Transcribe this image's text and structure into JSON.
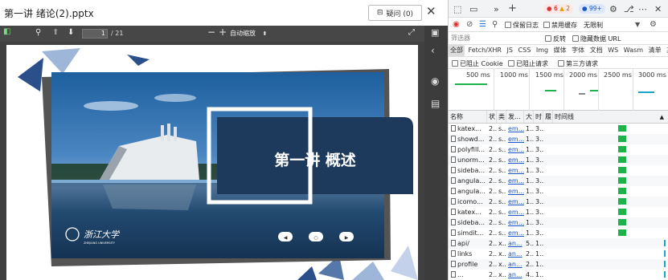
{
  "viewer": {
    "title": "第一讲 绪论(2).pptx",
    "question_button": "疑问 (0)",
    "page_current": "1",
    "page_total": "/ 21",
    "zoom_label": "自动缩放"
  },
  "slide": {
    "title": "第一讲  概述",
    "logo_text": "浙江大学",
    "logo_subtext": "ZHEJIANG UNIVERSITY",
    "nav_buttons": [
      "◀",
      "○",
      "▶"
    ]
  },
  "devtools": {
    "badges": {
      "errors": "6",
      "warnings": "2",
      "info": "99+"
    },
    "row2": {
      "preserve_log": "保留日志",
      "disable_cache": "禁用缓存",
      "throttle": "无限制"
    },
    "filter_placeholder": "筛选器",
    "invert": "反转",
    "hide_data_urls": "隐藏数据 URL",
    "type_tabs": [
      "全部",
      "Fetch/XHR",
      "JS",
      "CSS",
      "Img",
      "媒体",
      "字体",
      "文档",
      "WS",
      "Wasm",
      "清单",
      "其他"
    ],
    "blocked_cookies": "已阻止 Cookie",
    "blocked_requests": "已阻止请求",
    "third_party": "第三方请求",
    "timeline_labels": [
      "500 ms",
      "1000 ms",
      "1500 ms",
      "2000 ms",
      "2500 ms",
      "3000 ms"
    ],
    "columns": {
      "name": "名称",
      "status": "状",
      "type": "类",
      "initiator": "发...",
      "size": "大",
      "time": "时",
      "priority": "履",
      "waterfall": "时间线"
    },
    "requests": [
      {
        "name": "katex...",
        "status": "2...",
        "type": "s...",
        "initiator": "em...",
        "size": "1...",
        "time": "3...",
        "wf": 0.56,
        "wfw": 0.07
      },
      {
        "name": "showd...",
        "status": "2...",
        "type": "s...",
        "initiator": "em...",
        "size": "1...",
        "time": "3...",
        "wf": 0.56,
        "wfw": 0.07
      },
      {
        "name": "polyfill...",
        "status": "2...",
        "type": "s...",
        "initiator": "em...",
        "size": "1...",
        "time": "3...",
        "wf": 0.56,
        "wfw": 0.07
      },
      {
        "name": "unorm...",
        "status": "2...",
        "type": "s...",
        "initiator": "em...",
        "size": "1...",
        "time": "3...",
        "wf": 0.56,
        "wfw": 0.07
      },
      {
        "name": "sideba...",
        "status": "2...",
        "type": "s...",
        "initiator": "em...",
        "size": "1...",
        "time": "3...",
        "wf": 0.56,
        "wfw": 0.07
      },
      {
        "name": "angula...",
        "status": "2...",
        "type": "s...",
        "initiator": "em...",
        "size": "1...",
        "time": "3...",
        "wf": 0.56,
        "wfw": 0.07
      },
      {
        "name": "angula...",
        "status": "2...",
        "type": "s...",
        "initiator": "em...",
        "size": "1...",
        "time": "3...",
        "wf": 0.56,
        "wfw": 0.07
      },
      {
        "name": "icomo...",
        "status": "2...",
        "type": "s...",
        "initiator": "em...",
        "size": "1...",
        "time": "3...",
        "wf": 0.56,
        "wfw": 0.07
      },
      {
        "name": "katex...",
        "status": "2...",
        "type": "s...",
        "initiator": "em...",
        "size": "1...",
        "time": "3...",
        "wf": 0.56,
        "wfw": 0.07
      },
      {
        "name": "sideba...",
        "status": "2...",
        "type": "s...",
        "initiator": "em...",
        "size": "1...",
        "time": "3...",
        "wf": 0.56,
        "wfw": 0.07
      },
      {
        "name": "simdit...",
        "status": "2...",
        "type": "s...",
        "initiator": "em...",
        "size": "1...",
        "time": "3...",
        "wf": 0.56,
        "wfw": 0.07
      },
      {
        "name": "api/",
        "status": "2...",
        "type": "x...",
        "initiator": "an...",
        "size": "5...",
        "time": "1...",
        "wf": 0.96,
        "wfw": 0
      },
      {
        "name": "links",
        "status": "2...",
        "type": "x...",
        "initiator": "an...",
        "size": "2...",
        "time": "1...",
        "wf": 0.96,
        "wfw": 0
      },
      {
        "name": "profile",
        "status": "2...",
        "type": "x...",
        "initiator": "an...",
        "size": "2...",
        "time": "1...",
        "wf": 0.96,
        "wfw": 0
      },
      {
        "name": "...",
        "status": "2...",
        "type": "x...",
        "initiator": "an...",
        "size": "4...",
        "time": "1...",
        "wf": 0.96,
        "wfw": 0
      }
    ]
  }
}
